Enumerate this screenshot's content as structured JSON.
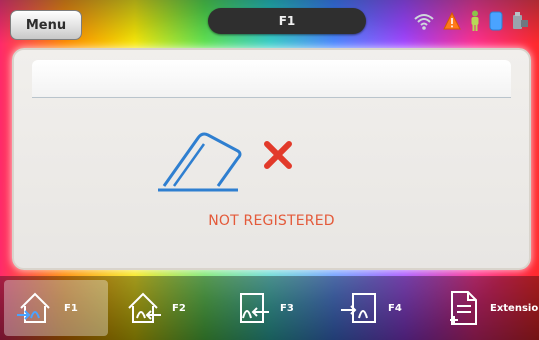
{
  "header": {
    "menu_label": "Menu",
    "title": "F1",
    "status_icons": [
      "wifi-icon",
      "warning-icon",
      "person-icon",
      "storage-icon",
      "usb-icon"
    ]
  },
  "main": {
    "status_text": "NOT REGISTERED",
    "card_icon": "card-icon",
    "status_icon": "x-mark-icon"
  },
  "function_keys": [
    {
      "label": "F1",
      "icon": "home-in-icon",
      "active": true
    },
    {
      "label": "F2",
      "icon": "home-out-icon",
      "active": false
    },
    {
      "label": "F3",
      "icon": "person-out-icon",
      "active": false
    },
    {
      "label": "F4",
      "icon": "person-in-icon",
      "active": false
    },
    {
      "label": "Extension",
      "icon": "document-add-icon",
      "active": false
    }
  ],
  "colors": {
    "status_text": "#e45a3a",
    "x_mark": "#e23a2a",
    "card_icon": "#2f7fd0",
    "title_pill": "#2f2f2f"
  }
}
